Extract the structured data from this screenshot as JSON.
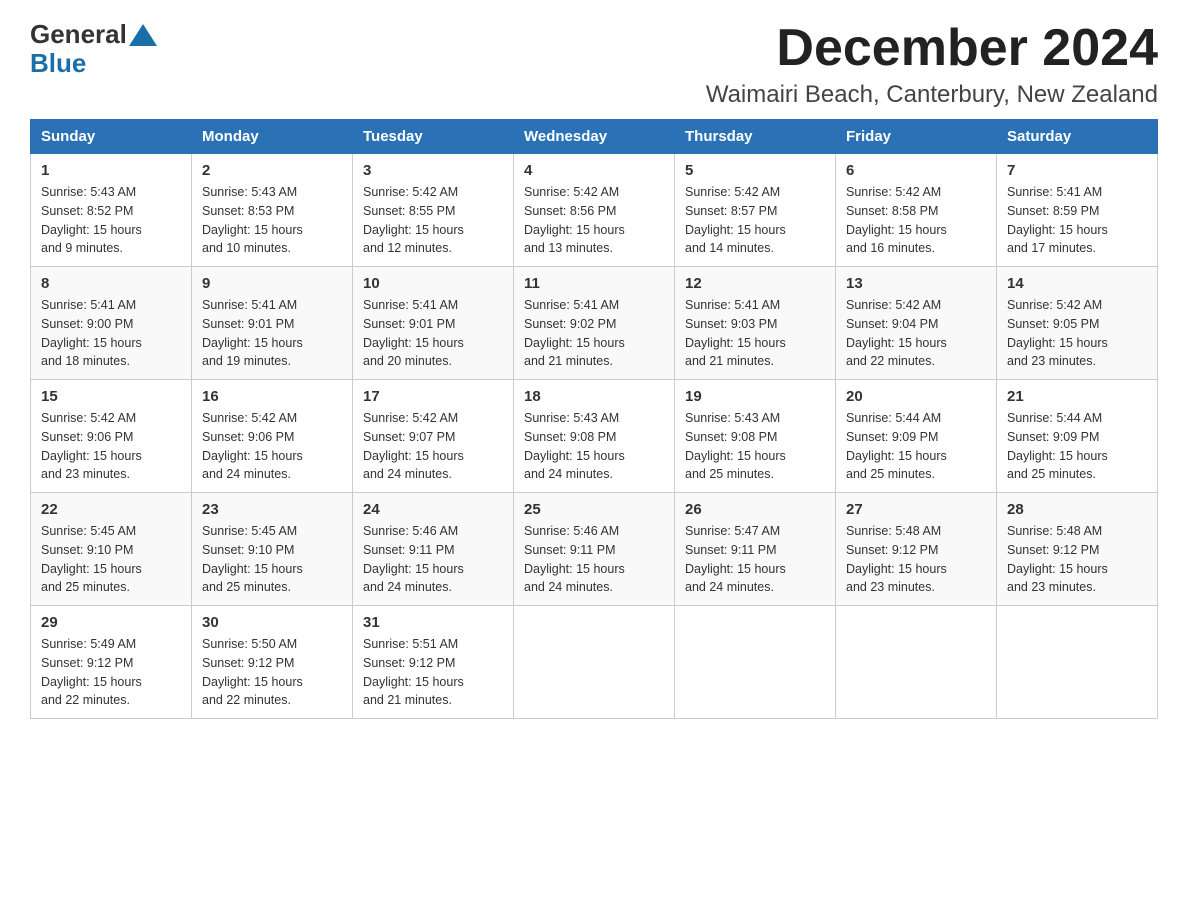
{
  "header": {
    "logo_general": "General",
    "logo_blue": "Blue",
    "month_title": "December 2024",
    "location": "Waimairi Beach, Canterbury, New Zealand"
  },
  "columns": [
    "Sunday",
    "Monday",
    "Tuesday",
    "Wednesday",
    "Thursday",
    "Friday",
    "Saturday"
  ],
  "weeks": [
    [
      {
        "day": "1",
        "sunrise": "5:43 AM",
        "sunset": "8:52 PM",
        "daylight": "15 hours and 9 minutes."
      },
      {
        "day": "2",
        "sunrise": "5:43 AM",
        "sunset": "8:53 PM",
        "daylight": "15 hours and 10 minutes."
      },
      {
        "day": "3",
        "sunrise": "5:42 AM",
        "sunset": "8:55 PM",
        "daylight": "15 hours and 12 minutes."
      },
      {
        "day": "4",
        "sunrise": "5:42 AM",
        "sunset": "8:56 PM",
        "daylight": "15 hours and 13 minutes."
      },
      {
        "day": "5",
        "sunrise": "5:42 AM",
        "sunset": "8:57 PM",
        "daylight": "15 hours and 14 minutes."
      },
      {
        "day": "6",
        "sunrise": "5:42 AM",
        "sunset": "8:58 PM",
        "daylight": "15 hours and 16 minutes."
      },
      {
        "day": "7",
        "sunrise": "5:41 AM",
        "sunset": "8:59 PM",
        "daylight": "15 hours and 17 minutes."
      }
    ],
    [
      {
        "day": "8",
        "sunrise": "5:41 AM",
        "sunset": "9:00 PM",
        "daylight": "15 hours and 18 minutes."
      },
      {
        "day": "9",
        "sunrise": "5:41 AM",
        "sunset": "9:01 PM",
        "daylight": "15 hours and 19 minutes."
      },
      {
        "day": "10",
        "sunrise": "5:41 AM",
        "sunset": "9:01 PM",
        "daylight": "15 hours and 20 minutes."
      },
      {
        "day": "11",
        "sunrise": "5:41 AM",
        "sunset": "9:02 PM",
        "daylight": "15 hours and 21 minutes."
      },
      {
        "day": "12",
        "sunrise": "5:41 AM",
        "sunset": "9:03 PM",
        "daylight": "15 hours and 21 minutes."
      },
      {
        "day": "13",
        "sunrise": "5:42 AM",
        "sunset": "9:04 PM",
        "daylight": "15 hours and 22 minutes."
      },
      {
        "day": "14",
        "sunrise": "5:42 AM",
        "sunset": "9:05 PM",
        "daylight": "15 hours and 23 minutes."
      }
    ],
    [
      {
        "day": "15",
        "sunrise": "5:42 AM",
        "sunset": "9:06 PM",
        "daylight": "15 hours and 23 minutes."
      },
      {
        "day": "16",
        "sunrise": "5:42 AM",
        "sunset": "9:06 PM",
        "daylight": "15 hours and 24 minutes."
      },
      {
        "day": "17",
        "sunrise": "5:42 AM",
        "sunset": "9:07 PM",
        "daylight": "15 hours and 24 minutes."
      },
      {
        "day": "18",
        "sunrise": "5:43 AM",
        "sunset": "9:08 PM",
        "daylight": "15 hours and 24 minutes."
      },
      {
        "day": "19",
        "sunrise": "5:43 AM",
        "sunset": "9:08 PM",
        "daylight": "15 hours and 25 minutes."
      },
      {
        "day": "20",
        "sunrise": "5:44 AM",
        "sunset": "9:09 PM",
        "daylight": "15 hours and 25 minutes."
      },
      {
        "day": "21",
        "sunrise": "5:44 AM",
        "sunset": "9:09 PM",
        "daylight": "15 hours and 25 minutes."
      }
    ],
    [
      {
        "day": "22",
        "sunrise": "5:45 AM",
        "sunset": "9:10 PM",
        "daylight": "15 hours and 25 minutes."
      },
      {
        "day": "23",
        "sunrise": "5:45 AM",
        "sunset": "9:10 PM",
        "daylight": "15 hours and 25 minutes."
      },
      {
        "day": "24",
        "sunrise": "5:46 AM",
        "sunset": "9:11 PM",
        "daylight": "15 hours and 24 minutes."
      },
      {
        "day": "25",
        "sunrise": "5:46 AM",
        "sunset": "9:11 PM",
        "daylight": "15 hours and 24 minutes."
      },
      {
        "day": "26",
        "sunrise": "5:47 AM",
        "sunset": "9:11 PM",
        "daylight": "15 hours and 24 minutes."
      },
      {
        "day": "27",
        "sunrise": "5:48 AM",
        "sunset": "9:12 PM",
        "daylight": "15 hours and 23 minutes."
      },
      {
        "day": "28",
        "sunrise": "5:48 AM",
        "sunset": "9:12 PM",
        "daylight": "15 hours and 23 minutes."
      }
    ],
    [
      {
        "day": "29",
        "sunrise": "5:49 AM",
        "sunset": "9:12 PM",
        "daylight": "15 hours and 22 minutes."
      },
      {
        "day": "30",
        "sunrise": "5:50 AM",
        "sunset": "9:12 PM",
        "daylight": "15 hours and 22 minutes."
      },
      {
        "day": "31",
        "sunrise": "5:51 AM",
        "sunset": "9:12 PM",
        "daylight": "15 hours and 21 minutes."
      },
      null,
      null,
      null,
      null
    ]
  ],
  "labels": {
    "sunrise": "Sunrise:",
    "sunset": "Sunset:",
    "daylight": "Daylight:"
  }
}
